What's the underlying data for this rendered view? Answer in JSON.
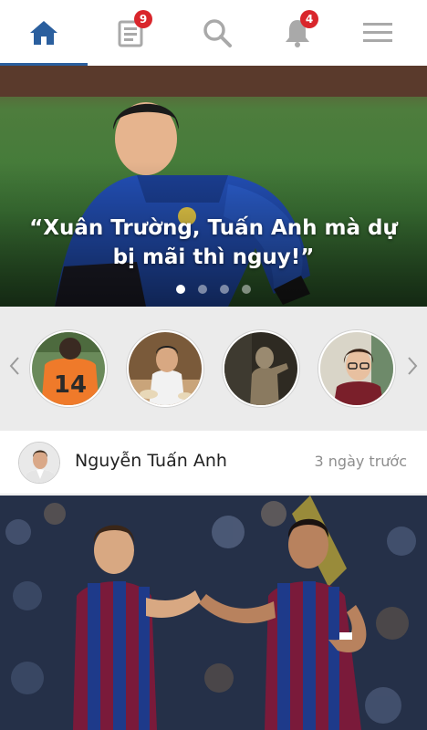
{
  "nav": {
    "tabs": [
      {
        "name": "home",
        "icon": "home-icon",
        "active": true
      },
      {
        "name": "news",
        "icon": "news-icon",
        "badge": "9"
      },
      {
        "name": "search",
        "icon": "search-icon"
      },
      {
        "name": "notifications",
        "icon": "bell-icon",
        "badge": "4"
      },
      {
        "name": "menu",
        "icon": "hamburger-icon"
      }
    ],
    "active_color": "#2b5f9e",
    "badge_color": "#d9262c"
  },
  "hero": {
    "quote": "“Xuân Trường, Tuấn Anh mà dự bị mãi thì nguy!”",
    "slide_count": 4,
    "active_slide": 1
  },
  "carousel": {
    "left_arrow": "‹",
    "right_arrow": "›",
    "authors": [
      {
        "id": "author-1",
        "icon": "player-jersey-14-avatar"
      },
      {
        "id": "author-2",
        "icon": "man-at-table-avatar"
      },
      {
        "id": "author-3",
        "icon": "statue-avatar"
      },
      {
        "id": "author-4",
        "icon": "young-man-glasses-avatar"
      }
    ]
  },
  "post": {
    "author": "Nguyễn Tuấn Anh",
    "time": "3 ngày trước",
    "image_icon": "football-players-photo"
  }
}
